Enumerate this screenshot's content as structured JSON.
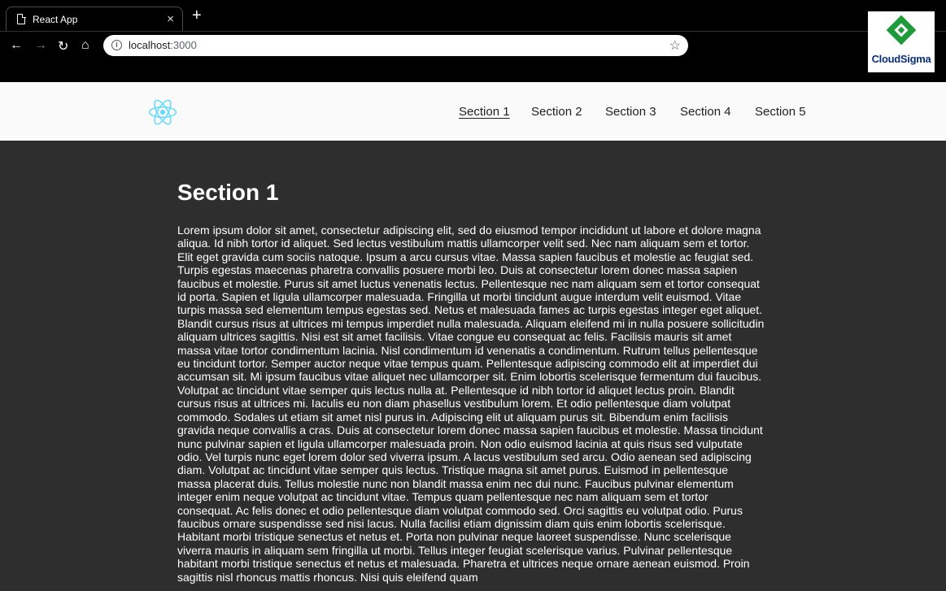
{
  "browser": {
    "tab_title": "React App",
    "tab_close": "×",
    "new_tab": "+",
    "url_host": "localhost",
    "url_port": ":3000",
    "extension_brand": "CloudSigma"
  },
  "header": {
    "nav": [
      {
        "label": "Section 1",
        "active": true
      },
      {
        "label": "Section 2",
        "active": false
      },
      {
        "label": "Section 3",
        "active": false
      },
      {
        "label": "Section 4",
        "active": false
      },
      {
        "label": "Section 5",
        "active": false
      }
    ],
    "logo_color": "#61dafb"
  },
  "main": {
    "title": "Section 1",
    "body": "Lorem ipsum dolor sit amet, consectetur adipiscing elit, sed do eiusmod tempor incididunt ut labore et dolore magna aliqua. Id nibh tortor id aliquet. Sed lectus vestibulum mattis ullamcorper velit sed. Nec nam aliquam sem et tortor. Elit eget gravida cum sociis natoque. Ipsum a arcu cursus vitae. Massa sapien faucibus et molestie ac feugiat sed. Turpis egestas maecenas pharetra convallis posuere morbi leo. Duis at consectetur lorem donec massa sapien faucibus et molestie. Purus sit amet luctus venenatis lectus. Pellentesque nec nam aliquam sem et tortor consequat id porta. Sapien et ligula ullamcorper malesuada. Fringilla ut morbi tincidunt augue interdum velit euismod. Vitae turpis massa sed elementum tempus egestas sed. Netus et malesuada fames ac turpis egestas integer eget aliquet. Blandit cursus risus at ultrices mi tempus imperdiet nulla malesuada. Aliquam eleifend mi in nulla posuere sollicitudin aliquam ultrices sagittis. Nisi est sit amet facilisis. Vitae congue eu consequat ac felis. Facilisis mauris sit amet massa vitae tortor condimentum lacinia. Nisl condimentum id venenatis a condimentum. Rutrum tellus pellentesque eu tincidunt tortor. Semper auctor neque vitae tempus quam. Pellentesque adipiscing commodo elit at imperdiet dui accumsan sit. Mi ipsum faucibus vitae aliquet nec ullamcorper sit. Enim lobortis scelerisque fermentum dui faucibus. Volutpat ac tincidunt vitae semper quis lectus nulla at. Pellentesque id nibh tortor id aliquet lectus proin. Blandit cursus risus at ultrices mi. Iaculis eu non diam phasellus vestibulum lorem. Et odio pellentesque diam volutpat commodo. Sodales ut etiam sit amet nisl purus in. Adipiscing elit ut aliquam purus sit. Bibendum enim facilisis gravida neque convallis a cras. Duis at consectetur lorem donec massa sapien faucibus et molestie. Massa tincidunt nunc pulvinar sapien et ligula ullamcorper malesuada proin. Non odio euismod lacinia at quis risus sed vulputate odio. Vel turpis nunc eget lorem dolor sed viverra ipsum. A lacus vestibulum sed arcu. Odio aenean sed adipiscing diam. Volutpat ac tincidunt vitae semper quis lectus. Tristique magna sit amet purus. Euismod in pellentesque massa placerat duis. Tellus molestie nunc non blandit massa enim nec dui nunc. Faucibus pulvinar elementum integer enim neque volutpat ac tincidunt vitae. Tempus quam pellentesque nec nam aliquam sem et tortor consequat. Ac felis donec et odio pellentesque diam volutpat commodo sed. Orci sagittis eu volutpat odio. Purus faucibus ornare suspendisse sed nisi lacus. Nulla facilisi etiam dignissim diam quis enim lobortis scelerisque. Habitant morbi tristique senectus et netus et. Porta non pulvinar neque laoreet suspendisse. Nunc scelerisque viverra mauris in aliquam sem fringilla ut morbi. Tellus integer feugiat scelerisque varius. Pulvinar pellentesque habitant morbi tristique senectus et netus et malesuada. Pharetra et ultrices neque ornare aenean euismod. Proin sagittis nisl rhoncus mattis rhoncus. Nisi quis eleifend quam"
  }
}
